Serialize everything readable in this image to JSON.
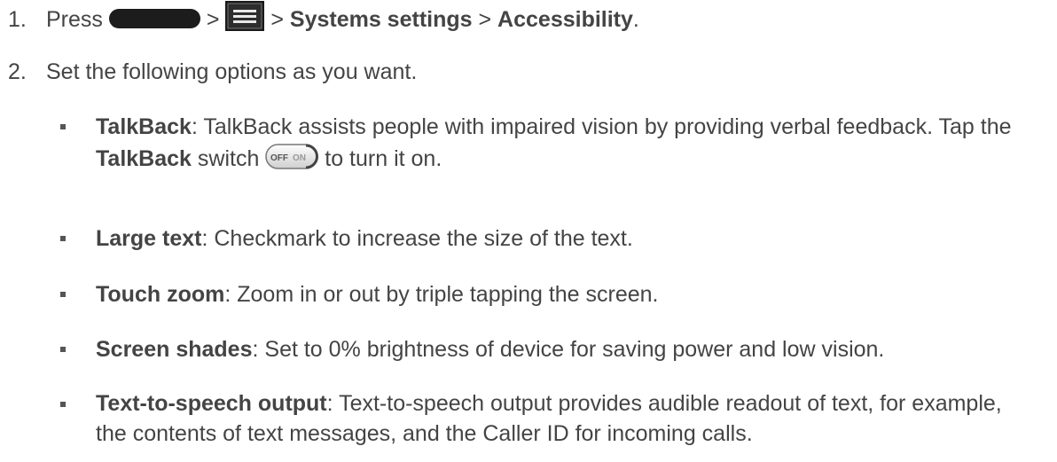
{
  "step1": {
    "number": "1.",
    "press": "Press",
    "sep1": ">",
    "sep2": ">",
    "systems_settings": "Systems settings",
    "sep3": ">",
    "accessibility": "Accessibility",
    "end": ".",
    "home_key_icon": "home-key-icon",
    "menu_key_icon": "menu-key-icon"
  },
  "step2": {
    "number": "2.",
    "text": "Set the following options as you want."
  },
  "options": {
    "talkback": {
      "term": "TalkBack",
      "colon": ":",
      "text_a": " TalkBack assists people with impaired vision by providing verbal feedback. Tap the ",
      "term2": "TalkBack",
      "text_b": " switch ",
      "text_c": " to turn it on.",
      "switch_off": "OFF",
      "switch_on": "ON"
    },
    "large_text": {
      "term": "Large text",
      "text": ": Checkmark to increase the size of the text."
    },
    "touch_zoom": {
      "term": "Touch zoom",
      "text": ": Zoom in or out by triple tapping the screen."
    },
    "screen_shades": {
      "term": "Screen shades",
      "text": ": Set to 0% brightness of device for saving power and low vision."
    },
    "tts": {
      "term": "Text-to-speech output",
      "text": ": Text-to-speech output provides audible readout of text, for example, the contents of text messages, and the Caller ID for incoming calls."
    }
  }
}
